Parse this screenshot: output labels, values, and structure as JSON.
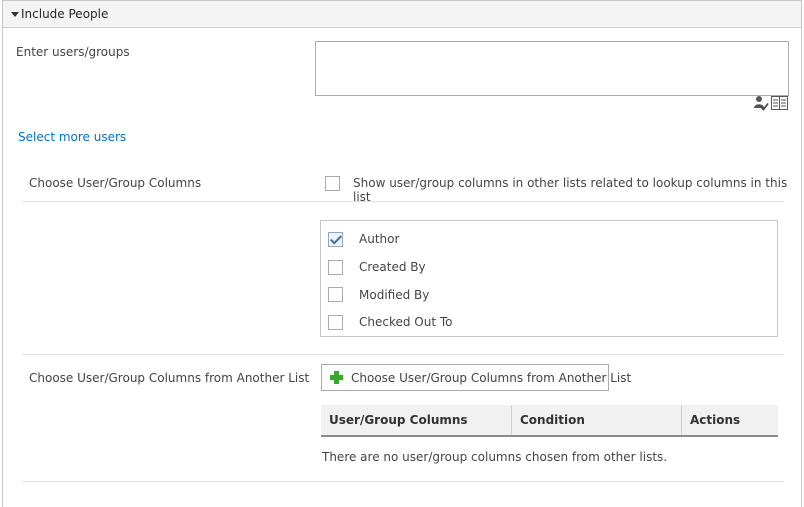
{
  "section": {
    "title": "Include People"
  },
  "people_picker": {
    "label": "Enter users/groups",
    "value": "",
    "check_names_icon": "check-names-icon",
    "browse_icon": "address-book-icon"
  },
  "select_more_users": "Select more users",
  "user_group_columns": {
    "label": "Choose User/Group Columns",
    "related_lists_checkbox": {
      "label": "Show user/group columns in other lists related to lookup columns in this list",
      "checked": false
    },
    "columns": [
      {
        "label": "Author",
        "checked": true
      },
      {
        "label": "Created By",
        "checked": false
      },
      {
        "label": "Modified By",
        "checked": false
      },
      {
        "label": "Checked Out To",
        "checked": false
      }
    ]
  },
  "another_list": {
    "label": "Choose User/Group Columns from Another List",
    "button_label": "Choose User/Group Columns from Another List",
    "grid_headers": [
      "User/Group Columns",
      "Condition",
      "Actions"
    ],
    "empty_message": "There are no user/group columns chosen from other lists."
  },
  "colors": {
    "link": "#0072c6",
    "add_icon": "#3aa830"
  }
}
